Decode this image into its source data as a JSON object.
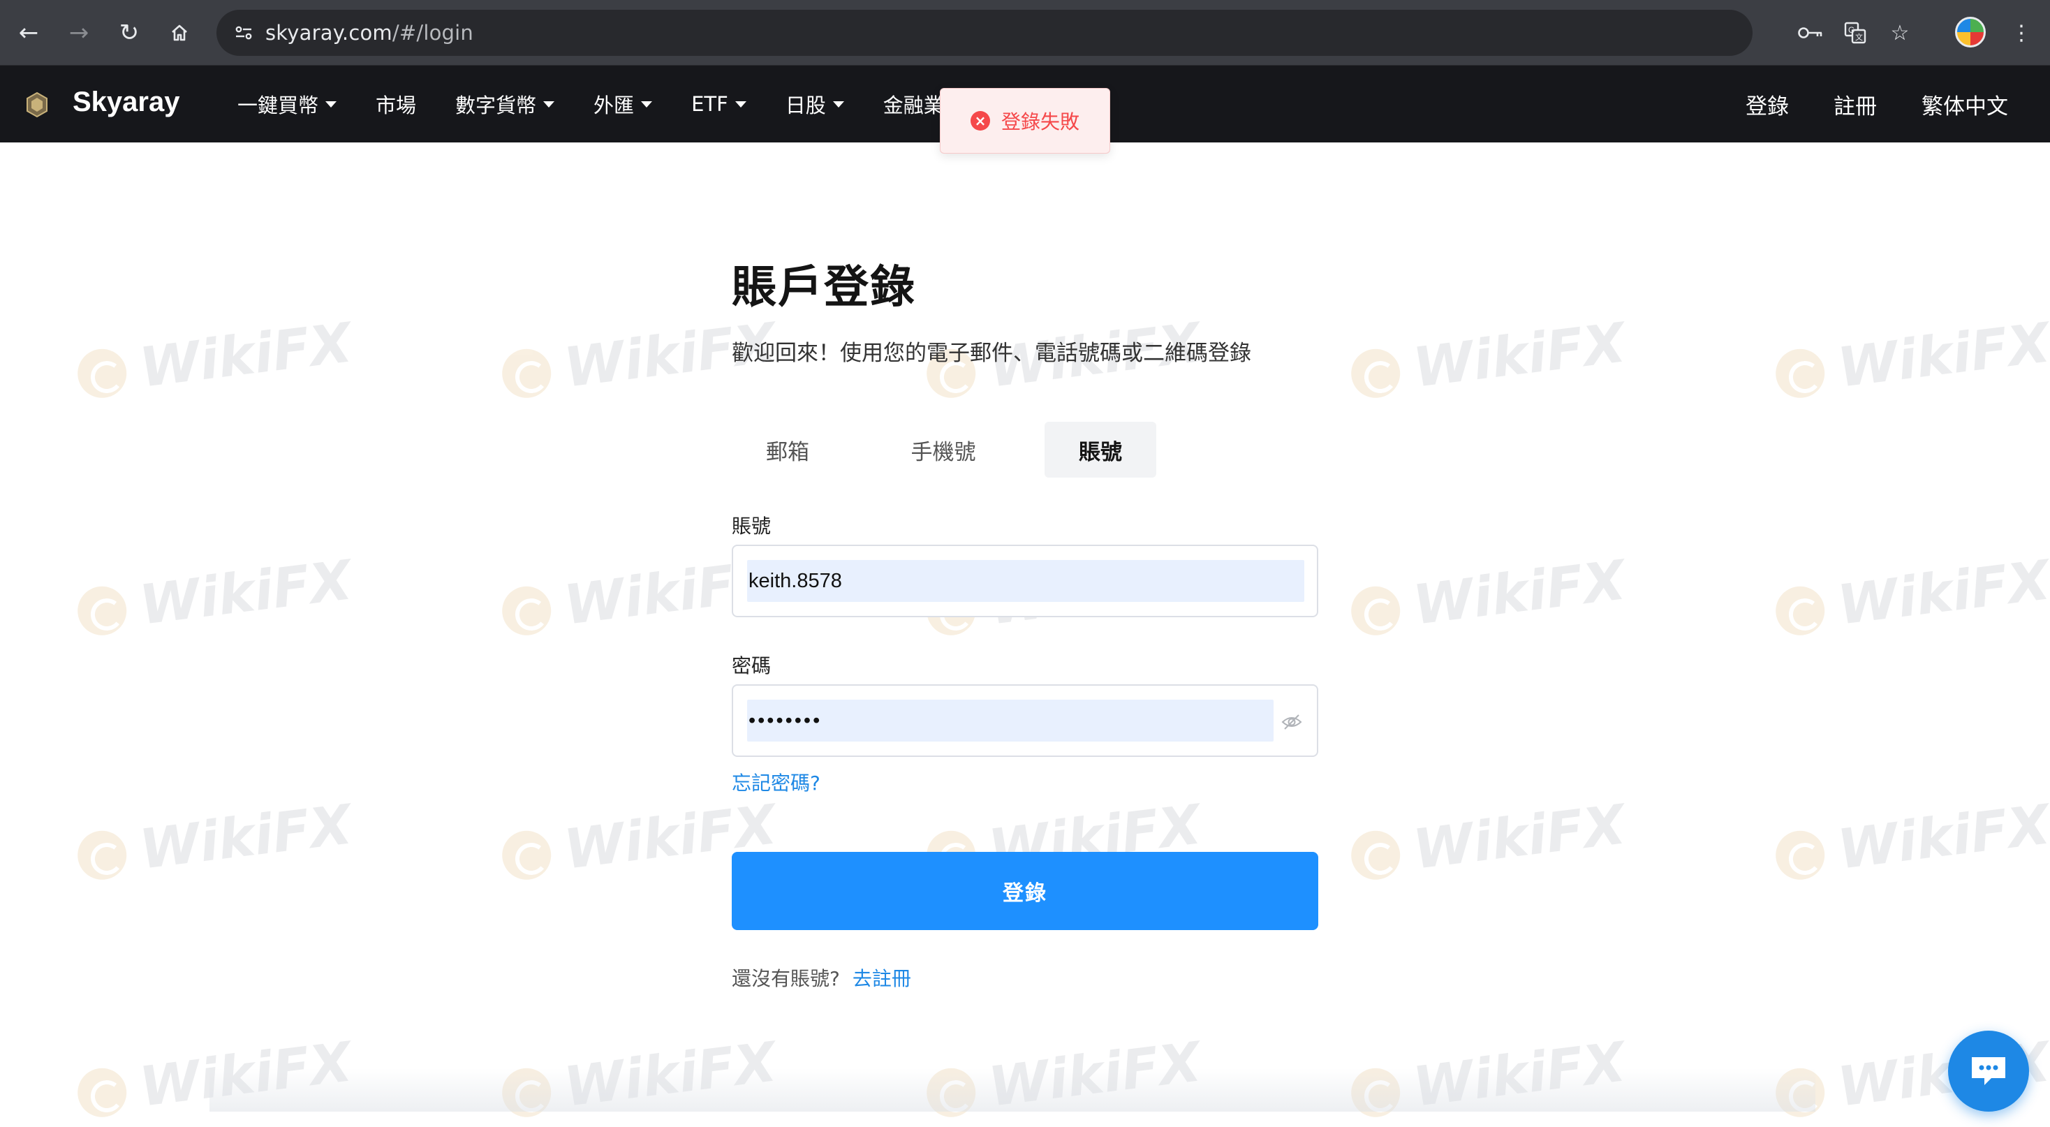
{
  "browser": {
    "url_host": "skyaray.com",
    "url_path": "/#/login"
  },
  "header": {
    "brand": "Skyaray",
    "menu": [
      {
        "label": "一鍵買幣",
        "dropdown": true
      },
      {
        "label": "市場",
        "dropdown": false
      },
      {
        "label": "數字貨幣",
        "dropdown": true
      },
      {
        "label": "外匯",
        "dropdown": true
      },
      {
        "label": "ETF",
        "dropdown": true
      },
      {
        "label": "日股",
        "dropdown": true
      },
      {
        "label": "金融業",
        "dropdown": false
      }
    ],
    "login": "登錄",
    "register": "註冊",
    "language": "繁体中文"
  },
  "toast": {
    "message": "登錄失敗",
    "type": "error",
    "color": "#f5484a"
  },
  "form": {
    "title": "賬戶登錄",
    "subtitle": "歡迎回來！使用您的電子郵件、電話號碼或二維碼登錄",
    "tabs": [
      {
        "label": "郵箱",
        "active": false
      },
      {
        "label": "手機號",
        "active": false
      },
      {
        "label": "賬號",
        "active": true
      }
    ],
    "account_label": "賬號",
    "account_value": "keith.8578",
    "password_label": "密碼",
    "password_value": "••••••••",
    "forgot": "忘記密碼?",
    "submit": "登錄",
    "no_account": "還沒有賬號?",
    "go_register": "去註冊"
  },
  "watermark": "WikiFX",
  "colors": {
    "primary": "#1e90ff",
    "link": "#1e88e5",
    "header_bg": "#16171b",
    "error": "#f5484a"
  }
}
